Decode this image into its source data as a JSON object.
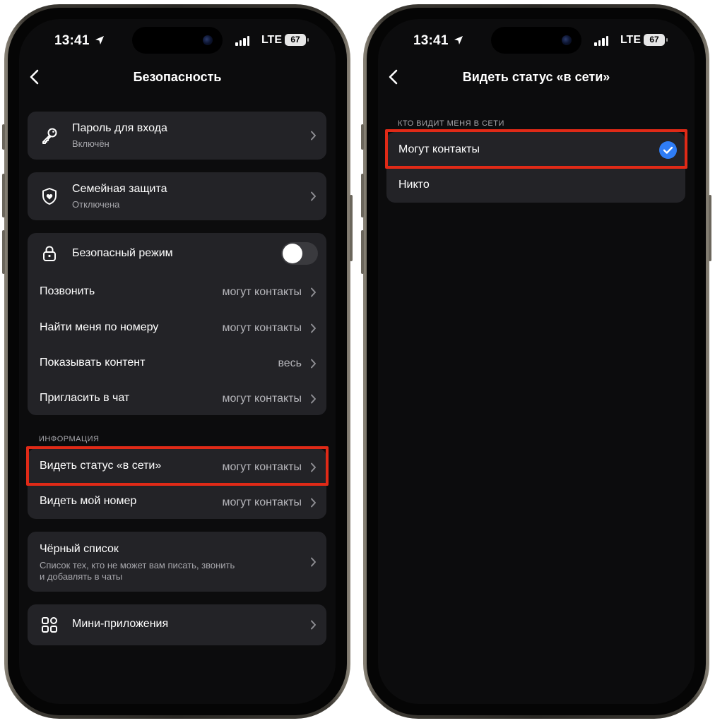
{
  "status_bar": {
    "time": "13:41",
    "network": "LTE",
    "battery": "67"
  },
  "left_screen": {
    "title": "Безопасность",
    "password": {
      "label": "Пароль для входа",
      "sub": "Включён"
    },
    "family": {
      "label": "Семейная защита",
      "sub": "Отключена"
    },
    "safe_mode": {
      "label": "Безопасный режим",
      "enabled": false
    },
    "settings": [
      {
        "label": "Позвонить",
        "value": "могут контакты"
      },
      {
        "label": "Найти меня по номеру",
        "value": "могут контакты"
      },
      {
        "label": "Показывать контент",
        "value": "весь"
      },
      {
        "label": "Пригласить в чат",
        "value": "могут контакты"
      }
    ],
    "info_header": "ИНФОРМАЦИЯ",
    "info": [
      {
        "label": "Видеть статус «в сети»",
        "value": "могут контакты"
      },
      {
        "label": "Видеть мой номер",
        "value": "могут контакты"
      }
    ],
    "blacklist": {
      "label": "Чёрный список",
      "sub_line1": "Список тех, кто не может вам писать, звонить",
      "sub_line2": "и добавлять в чаты"
    },
    "mini_apps": {
      "label": "Мини-приложения"
    }
  },
  "right_screen": {
    "title": "Видеть статус «в сети»",
    "section_header": "КТО ВИДИТ МЕНЯ В СЕТИ",
    "options": [
      {
        "label": "Могут контакты",
        "selected": true
      },
      {
        "label": "Никто",
        "selected": false
      }
    ]
  },
  "colors": {
    "background": "#0c0c0d",
    "card": "#232327",
    "highlight": "#e02a17",
    "accent": "#2f7df6"
  }
}
